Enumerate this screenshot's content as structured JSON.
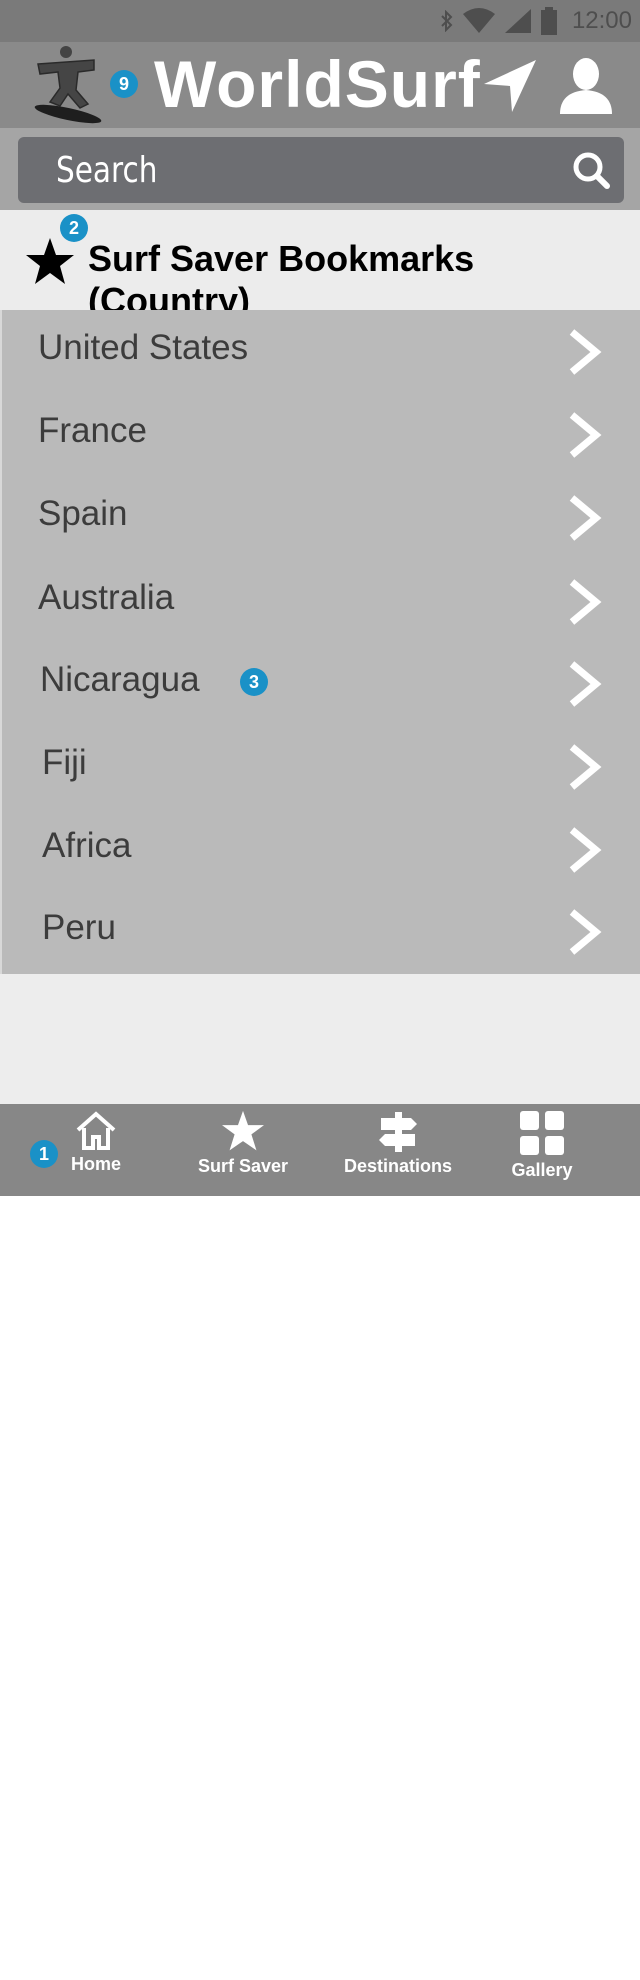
{
  "status_bar": {
    "time": "12:00",
    "icons": [
      "bluetooth-icon",
      "wifi-icon",
      "signal-icon",
      "battery-icon"
    ]
  },
  "app_bar": {
    "title": "WorldSurf",
    "logo": "surfer-logo-icon",
    "badge": "9",
    "actions": [
      "navigation-arrow-icon",
      "user-icon"
    ]
  },
  "search": {
    "placeholder": "Search",
    "icon": "search-icon"
  },
  "section": {
    "title": "Surf Saver Bookmarks (Country)",
    "badge": "2",
    "icon": "star-icon"
  },
  "countries": [
    {
      "label": "United States"
    },
    {
      "label": "France"
    },
    {
      "label": "Spain"
    },
    {
      "label": "Australia"
    },
    {
      "label": "Nicaragua",
      "badge": "3"
    },
    {
      "label": "Fiji"
    },
    {
      "label": "Africa"
    },
    {
      "label": "Peru"
    }
  ],
  "bottom_nav": {
    "badge": "1",
    "tabs": [
      {
        "label": "Home",
        "icon": "home-icon"
      },
      {
        "label": "Surf Saver",
        "icon": "star-icon"
      },
      {
        "label": "Destinations",
        "icon": "signpost-icon"
      },
      {
        "label": "Gallery",
        "icon": "grid-icon"
      }
    ]
  },
  "colors": {
    "badge": "#1a91c7",
    "app_bar": "#8a8a8a",
    "list_bg": "#bababa"
  }
}
